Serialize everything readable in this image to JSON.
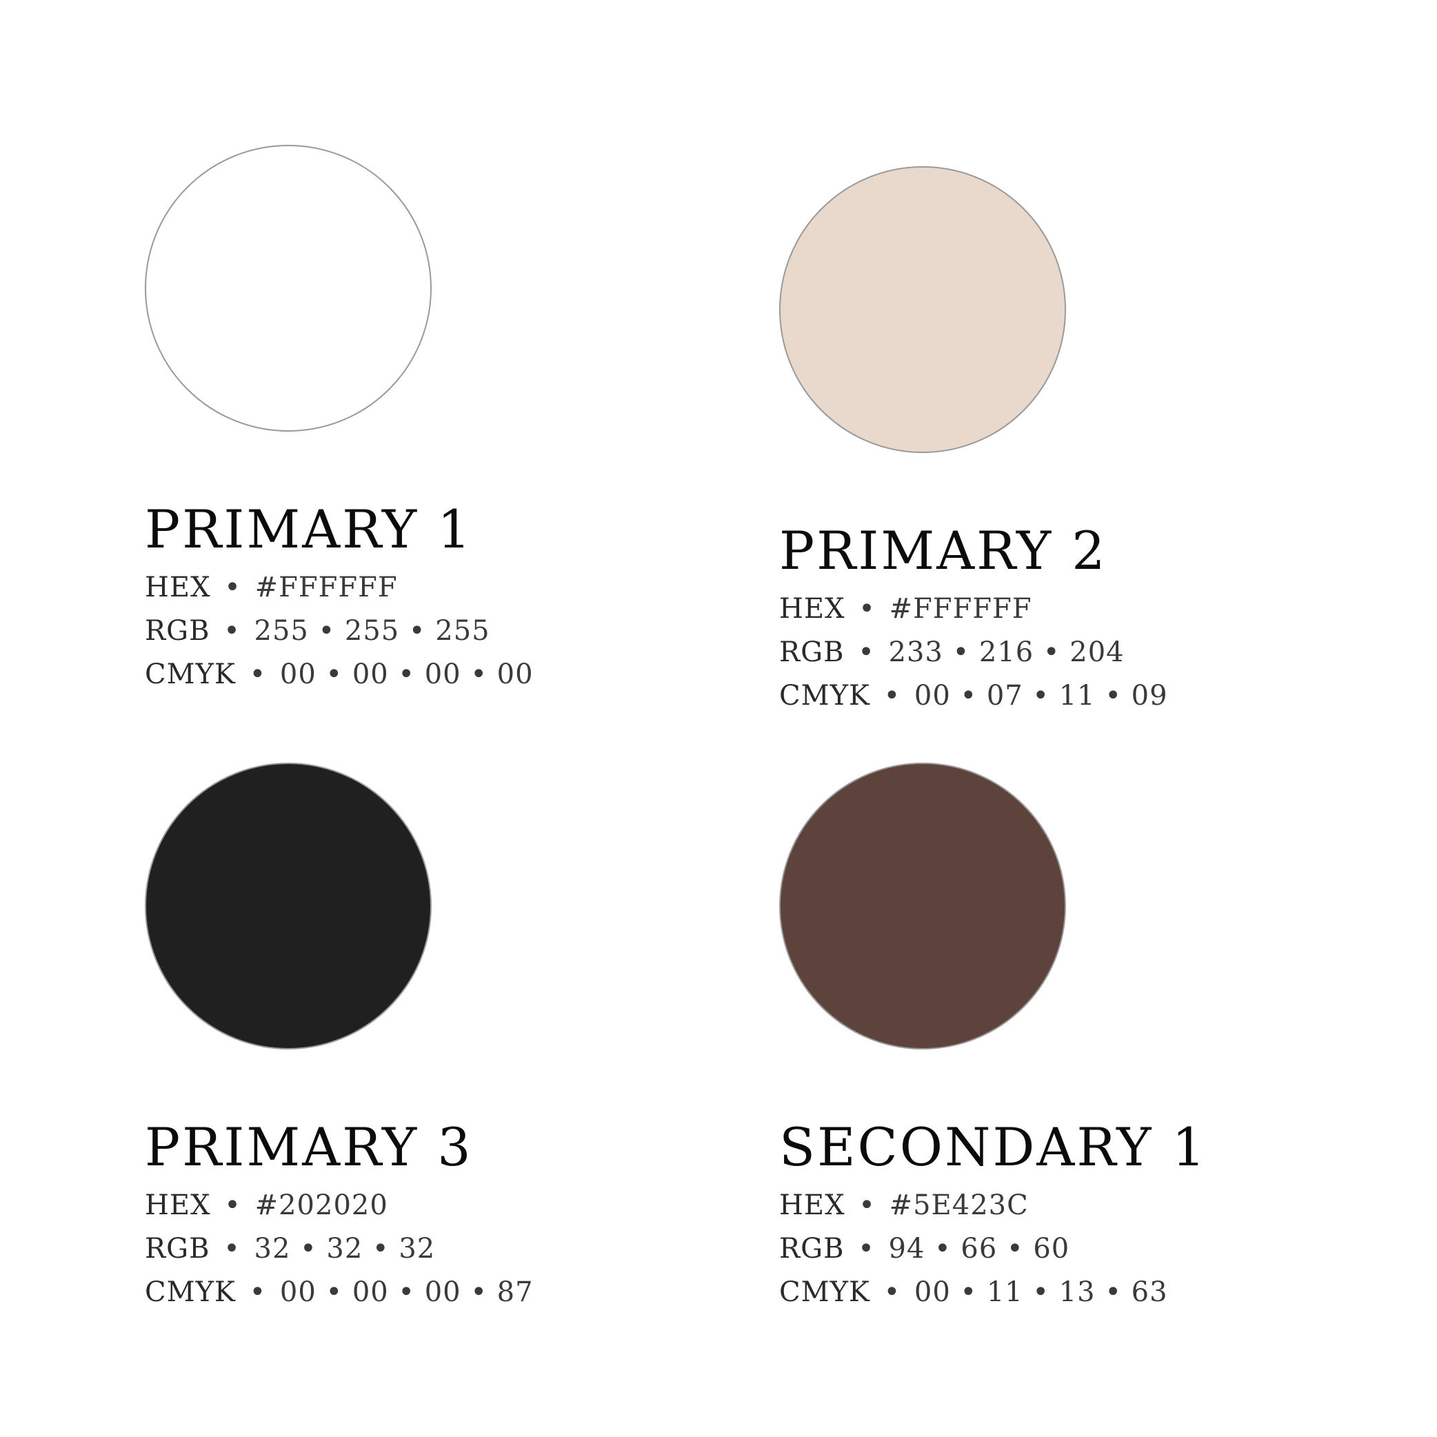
{
  "swatches": [
    {
      "title": "PRIMARY 1",
      "color": "#FFFFFF",
      "hex_label": "HEX",
      "hex_value": "#FFFFFF",
      "rgb_label": "RGB",
      "rgb_value": "255 • 255 • 255",
      "cmyk_label": "CMYK",
      "cmyk_value": "00 • 00 • 00 • 00"
    },
    {
      "title": "PRIMARY 2",
      "color": "#E9D8CC",
      "hex_label": "HEX",
      "hex_value": "#FFFFFF",
      "rgb_label": "RGB",
      "rgb_value": "233 • 216 • 204",
      "cmyk_label": "CMYK",
      "cmyk_value": "00 • 07 • 11 • 09"
    },
    {
      "title": "PRIMARY 3",
      "color": "#202020",
      "hex_label": "HEX",
      "hex_value": "#202020",
      "rgb_label": "RGB",
      "rgb_value": "32 • 32 • 32",
      "cmyk_label": "CMYK",
      "cmyk_value": "00 • 00 • 00 • 87"
    },
    {
      "title": "SECONDARY 1",
      "color": "#5E423C",
      "hex_label": "HEX",
      "hex_value": "#5E423C",
      "rgb_label": "RGB",
      "rgb_value": "94 • 66 • 60",
      "cmyk_label": "CMYK",
      "cmyk_value": "00 • 11 • 13 • 63"
    }
  ],
  "separator": "•"
}
